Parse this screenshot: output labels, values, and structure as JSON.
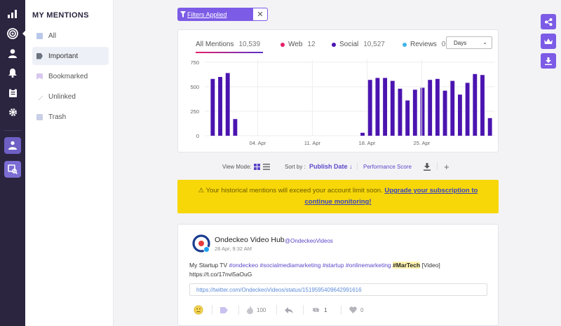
{
  "sidebar": {
    "title": "MY MENTIONS",
    "items": [
      {
        "label": "All",
        "icon": "file-icon"
      },
      {
        "label": "Important",
        "icon": "tag-icon"
      },
      {
        "label": "Bookmarked",
        "icon": "bookmark-icon"
      },
      {
        "label": "Unlinked",
        "icon": "unlink-icon"
      },
      {
        "label": "Trash",
        "icon": "trash-icon"
      }
    ]
  },
  "filters": {
    "label": "Filters Applied",
    "clear": "✕"
  },
  "tabs": [
    {
      "label": "All Mentions",
      "count": "10,539"
    },
    {
      "label": "Web",
      "count": "12",
      "color": "#e3206a"
    },
    {
      "label": "Social",
      "count": "10,527",
      "color": "#4b14b0"
    },
    {
      "label": "Reviews",
      "count": "0",
      "color": "#3fb6e8"
    }
  ],
  "range_select": {
    "value": "Days"
  },
  "chart_data": {
    "type": "bar",
    "ylim": [
      0,
      750
    ],
    "yticks": [
      0,
      250,
      500,
      750
    ],
    "xticks": [
      "04. Apr",
      "11. Apr",
      "18. Apr",
      "25. Apr"
    ],
    "values": [
      580,
      600,
      640,
      170,
      0,
      0,
      0,
      0,
      0,
      0,
      0,
      0,
      0,
      0,
      0,
      0,
      0,
      0,
      0,
      0,
      30,
      570,
      590,
      590,
      560,
      480,
      360,
      470,
      490,
      570,
      580,
      460,
      560,
      420,
      540,
      630,
      620,
      180
    ],
    "series": [
      {
        "values_ref": "values",
        "color": "#4b14b0"
      }
    ]
  },
  "toolbar": {
    "view_mode": "View Mode:",
    "sort_by": "Sort by :",
    "publish_date": "Publish Date ↓",
    "performance": "Performance Score"
  },
  "warning": {
    "text": "⚠ Your historical mentions will exceed your account limit soon.",
    "link": "Upgrade your subscription to continue monitoring!"
  },
  "post": {
    "author": "Ondeckeo Video Hub",
    "handle": "@OndeckeoVideos",
    "time": "28 Apr, 9:32 AM",
    "text_prefix": "My Startup TV",
    "hashtags": [
      "#ondeckeo",
      "#socialmediamarketing",
      "#startup",
      "#onlinemarketing"
    ],
    "highlight": "#MarTech",
    "text_suffix": "[Video]",
    "link_line": "https://t.co/17nvi5aOuG",
    "url": "https://twitter.com/OndeckeoVideos/status/1519595409642991616",
    "reach": "100",
    "retweets": "1",
    "likes": "0"
  }
}
